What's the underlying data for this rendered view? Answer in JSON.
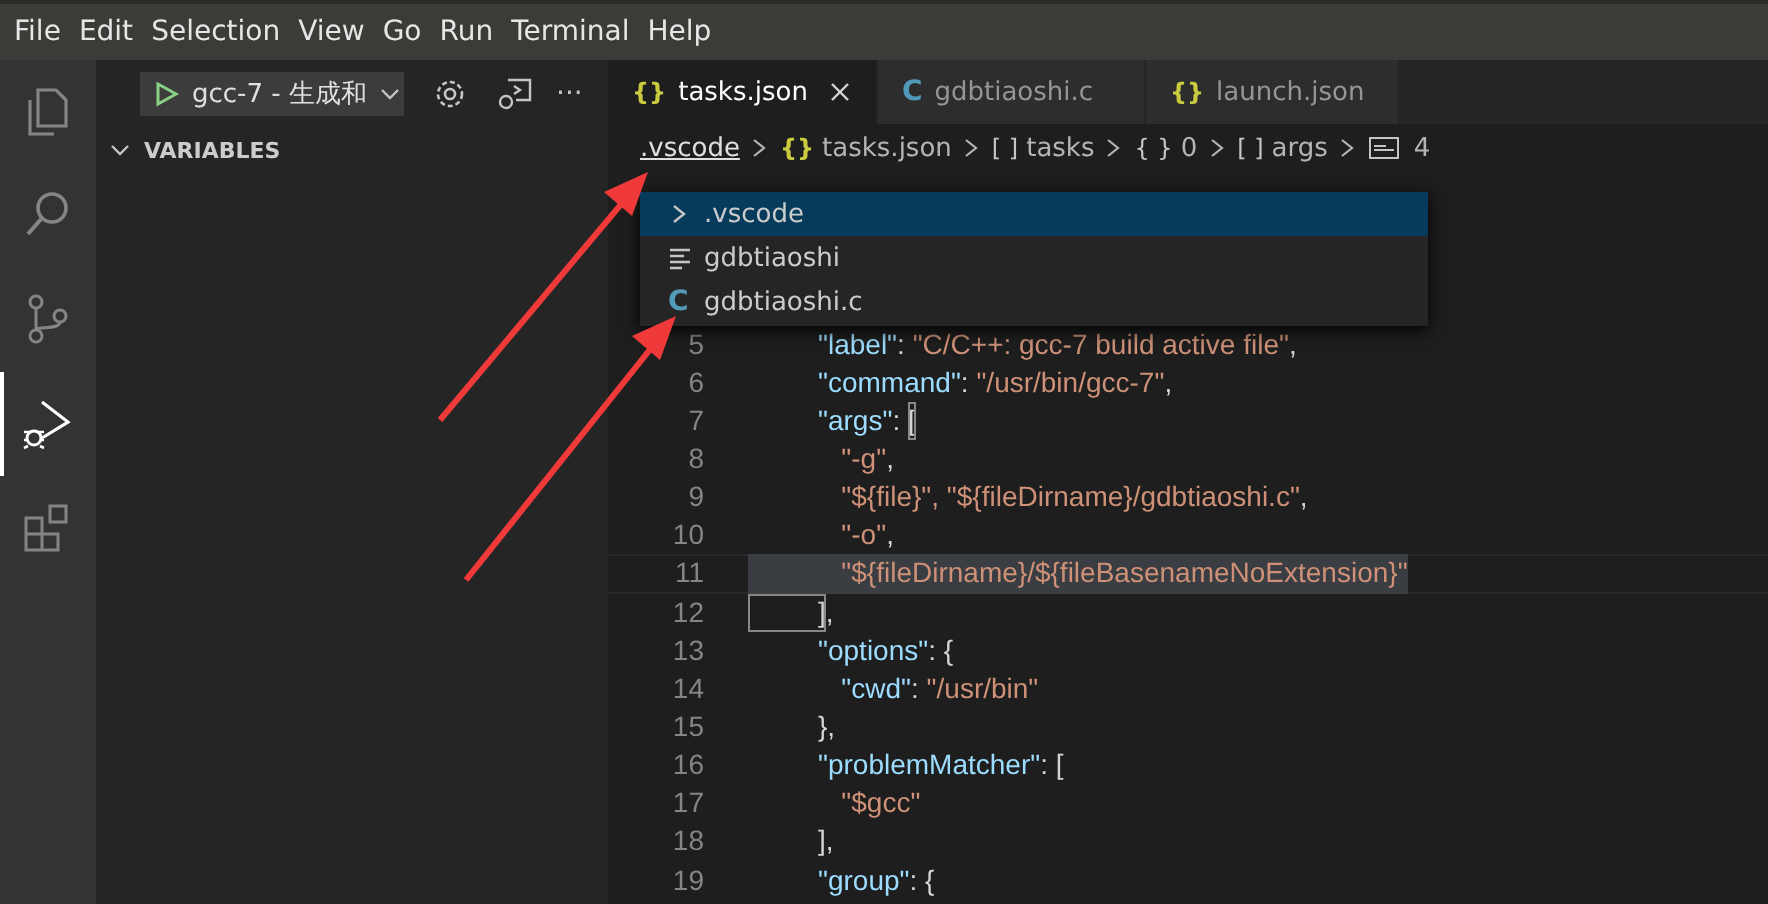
{
  "menu": [
    "File",
    "Edit",
    "Selection",
    "View",
    "Go",
    "Run",
    "Terminal",
    "Help"
  ],
  "activity_bar": [
    {
      "kind": "explorer",
      "selected": false
    },
    {
      "kind": "search",
      "selected": false
    },
    {
      "kind": "source-control",
      "selected": false
    },
    {
      "kind": "run",
      "selected": true
    },
    {
      "kind": "extensions",
      "selected": false
    }
  ],
  "debug_toolbar": {
    "configuration": "gcc-7 - 生成和",
    "more": "···"
  },
  "sidebar": {
    "section": {
      "title": "VARIABLES",
      "expanded": true
    }
  },
  "tabs": [
    {
      "kind": "json",
      "icon": "{}",
      "label": "tasks.json",
      "selected": true
    },
    {
      "kind": "c",
      "icon": "C",
      "label": "gdbtiaoshi.c",
      "selected": false
    },
    {
      "kind": "json",
      "icon": "{}",
      "label": "launch.json",
      "selected": false
    }
  ],
  "breadcrumb": [
    {
      "kind": "folder",
      "text": ".vscode",
      "selected": true
    },
    {
      "kind": "json",
      "icon": "{}",
      "text": "tasks.json",
      "selected": false
    },
    {
      "kind": "array",
      "icon": "[ ]",
      "text": "tasks",
      "selected": false
    },
    {
      "kind": "object",
      "icon": "{ }",
      "text": "0",
      "selected": false
    },
    {
      "kind": "array",
      "icon": "[ ]",
      "text": "args",
      "selected": false
    },
    {
      "kind": "string",
      "text": "4",
      "selected": false
    }
  ],
  "breadcrumb_dropdown": [
    {
      "kind": "folder",
      "text": ".vscode",
      "selected": true
    },
    {
      "kind": "file",
      "text": "gdbtiaoshi",
      "selected": false
    },
    {
      "kind": "c",
      "icon": "C",
      "text": "gdbtiaoshi.c",
      "selected": false
    }
  ],
  "code": [
    {
      "number": "5",
      "current": false,
      "tokens": [
        {
          "kind": "key",
          "text": "         \"label\""
        },
        {
          "kind": "punct",
          "text": ": "
        },
        {
          "kind": "string",
          "text": "\"C/C++: gcc-7 build active file\""
        },
        {
          "kind": "punct",
          "text": ","
        }
      ]
    },
    {
      "number": "6",
      "current": false,
      "tokens": [
        {
          "kind": "key",
          "text": "         \"command\""
        },
        {
          "kind": "punct",
          "text": ": "
        },
        {
          "kind": "string",
          "text": "\"/usr/bin/gcc-7\""
        },
        {
          "kind": "punct",
          "text": ","
        }
      ]
    },
    {
      "number": "7",
      "current": false,
      "tokens": [
        {
          "kind": "key",
          "text": "         \"args\""
        },
        {
          "kind": "punct",
          "text": ": "
        },
        {
          "kind": "bracket-match",
          "text": "["
        }
      ]
    },
    {
      "number": "8",
      "current": false,
      "tokens": [
        {
          "kind": "string",
          "text": "            \"-g\""
        },
        {
          "kind": "punct",
          "text": ","
        }
      ]
    },
    {
      "number": "9",
      "current": false,
      "tokens": [
        {
          "kind": "string",
          "text": "            \"${file}\", \"${fileDirname}/gdbtiaoshi.c\""
        },
        {
          "kind": "punct",
          "text": ","
        }
      ]
    },
    {
      "number": "10",
      "current": false,
      "tokens": [
        {
          "kind": "string",
          "text": "            \"-o\""
        },
        {
          "kind": "punct",
          "text": ","
        }
      ]
    },
    {
      "number": "11",
      "current": true,
      "tokens": [
        {
          "kind": "string",
          "text": "            \"${fileDirname}/${fileBasenameNoExtension}\""
        }
      ]
    },
    {
      "number": "12",
      "current": false,
      "tokens": [
        {
          "kind": "bracket-match",
          "text": "         ]"
        },
        {
          "kind": "punct",
          "text": ","
        }
      ]
    },
    {
      "number": "13",
      "current": false,
      "tokens": [
        {
          "kind": "key",
          "text": "         \"options\""
        },
        {
          "kind": "punct",
          "text": ": {"
        }
      ]
    },
    {
      "number": "14",
      "current": false,
      "tokens": [
        {
          "kind": "key",
          "text": "            \"cwd\""
        },
        {
          "kind": "punct",
          "text": ": "
        },
        {
          "kind": "string",
          "text": "\"/usr/bin\""
        }
      ]
    },
    {
      "number": "15",
      "current": false,
      "tokens": [
        {
          "kind": "punct",
          "text": "         },"
        }
      ]
    },
    {
      "number": "16",
      "current": false,
      "tokens": [
        {
          "kind": "key",
          "text": "         \"problemMatcher\""
        },
        {
          "kind": "punct",
          "text": ": ["
        }
      ]
    },
    {
      "number": "17",
      "current": false,
      "tokens": [
        {
          "kind": "string",
          "text": "            \"$gcc\""
        }
      ]
    },
    {
      "number": "18",
      "current": false,
      "tokens": [
        {
          "kind": "punct",
          "text": "         ],"
        }
      ]
    },
    {
      "number": "19",
      "current": false,
      "tokens": [
        {
          "kind": "key",
          "text": "         \"group\""
        },
        {
          "kind": "punct",
          "text": ": {"
        }
      ]
    }
  ]
}
